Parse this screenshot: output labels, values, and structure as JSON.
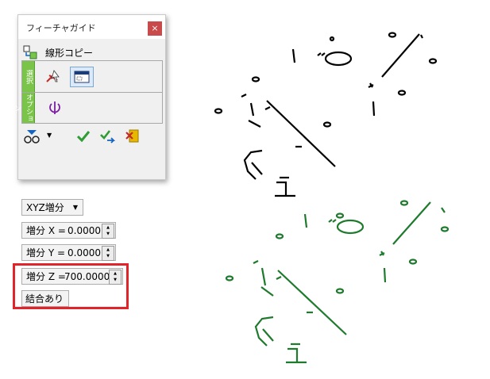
{
  "dialog": {
    "title": "フィーチャガイド",
    "close_label": "×",
    "command": {
      "label": "線形コピー",
      "icon": "linear-copy-icon"
    },
    "sections": [
      {
        "tab_label": "選択",
        "icons": [
          "select-cursor-icon",
          "window-select-icon"
        ]
      },
      {
        "tab_label": "オプション",
        "icons": [
          "rotate-axis-icon"
        ]
      }
    ],
    "toolbar_icons": [
      "snap-point-icon",
      "dropdown-arrow-icon",
      "ok-check-icon",
      "apply-check-icon",
      "cancel-exit-icon"
    ]
  },
  "options": {
    "mode": "XYZ増分",
    "increment_x": {
      "label": "増分 X =",
      "value": "0.0000"
    },
    "increment_y": {
      "label": "増分 Y =",
      "value": "0.0000"
    },
    "increment_z": {
      "label": "増分 Z =",
      "value": "700.0000"
    },
    "combine_button": "結合あり"
  },
  "colors": {
    "original_geometry": "#000000",
    "copied_geometry": "#1e7a2c",
    "highlight_frame": "#e0242a",
    "tab_green": "#7bc44a",
    "close_red": "#c94a4a"
  }
}
